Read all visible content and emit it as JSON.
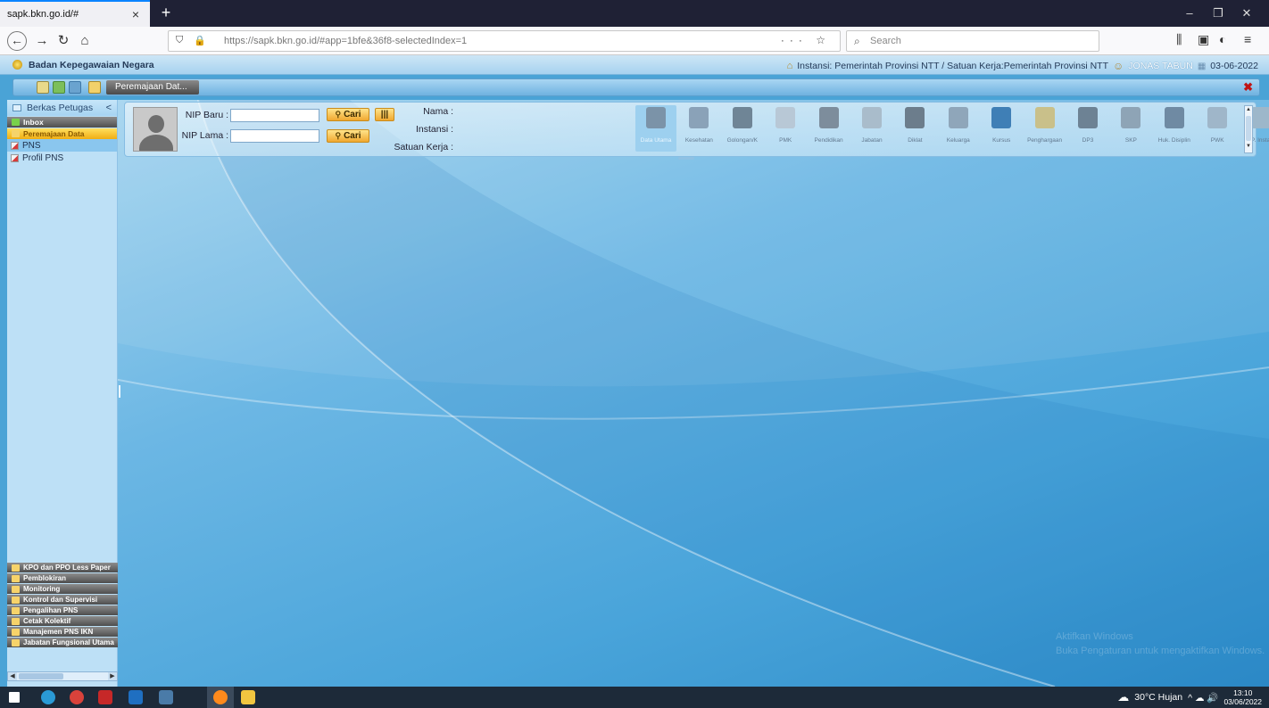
{
  "browser": {
    "tab_title": "sapk.bkn.go.id/#",
    "tab_close": "×",
    "new_tab": "+",
    "url": "https://sapk.bkn.go.id/#app=1bfe&36f8-selectedIndex=1",
    "search_placeholder": "Search",
    "url_actions": "··· ☆",
    "window_controls": [
      "–",
      "❐",
      "✕"
    ]
  },
  "header": {
    "org_name": "Badan Kepegawaian Negara",
    "instansi": "Instansi: Pemerintah Provinsi NTT / Satuan Kerja:Pemerintah Provinsi NTT",
    "user": "JONAS TABUN",
    "date": "03-06-2022"
  },
  "toolbar": {
    "tab_label": "Peremajaan Dat...",
    "close": "✖"
  },
  "sidebar": {
    "title": "Berkas Petugas",
    "collapse": "<",
    "groups_top": [
      {
        "label": "Inbox"
      },
      {
        "label": "Peremajaan Data"
      }
    ],
    "items": [
      {
        "label": "PNS"
      },
      {
        "label": "Profil PNS"
      }
    ],
    "groups_bottom": [
      {
        "label": "KPO dan PPO Less Paper"
      },
      {
        "label": "Pemblokiran"
      },
      {
        "label": "Monitoring"
      },
      {
        "label": "Kontrol dan Supervisi"
      },
      {
        "label": "Pengalihan PNS"
      },
      {
        "label": "Cetak Kolektif"
      },
      {
        "label": "Manajemen PNS IKN"
      },
      {
        "label": "Jabatan Fungsional Utama"
      }
    ]
  },
  "search": {
    "nip_baru_label": "NIP Baru :",
    "nip_lama_label": "NIP Lama :",
    "nip_baru_value": "",
    "nip_lama_value": "",
    "cari_label": "Cari",
    "barcode_label": "|||",
    "nama_label": "Nama :",
    "instansi_label": "Instansi :",
    "satuan_kerja_label": "Satuan Kerja :"
  },
  "modules": [
    {
      "label": "Data Utama",
      "icon": "database-icon",
      "color": "#7b93a8"
    },
    {
      "label": "Kesehatan",
      "icon": "health-icon",
      "color": "#8aa2b8"
    },
    {
      "label": "Golongan/K",
      "icon": "rank-icon",
      "color": "#6f8596"
    },
    {
      "label": "PMK",
      "icon": "magnifier-icon",
      "color": "#b8c8d6"
    },
    {
      "label": "Pendidikan",
      "icon": "graduate-icon",
      "color": "#7d8d9c"
    },
    {
      "label": "Jabatan",
      "icon": "id-card-icon",
      "color": "#a9bccb"
    },
    {
      "label": "Diklat",
      "icon": "book-icon",
      "color": "#6c7d8c"
    },
    {
      "label": "Keluarga",
      "icon": "family-icon",
      "color": "#8fa6ba"
    },
    {
      "label": "Kursus",
      "icon": "diamond-icon",
      "color": "#3f7fb6"
    },
    {
      "label": "Penghargaan",
      "icon": "medal-icon",
      "color": "#c9c08a"
    },
    {
      "label": "DP3",
      "icon": "document-icon",
      "color": "#6d8294"
    },
    {
      "label": "SKP",
      "icon": "people-icon",
      "color": "#8ea4b6"
    },
    {
      "label": "Huk. Disiplin",
      "icon": "person-icon",
      "color": "#6f8aa3"
    },
    {
      "label": "PWK",
      "icon": "map-icon",
      "color": "#9fb6c9"
    },
    {
      "label": "P. Insta",
      "icon": "chart-icon",
      "color": "#9db7ca"
    }
  ],
  "watermark": {
    "line1": "Aktifkan Windows",
    "line2": "Buka Pengaturan untuk mengaktifkan Windows."
  },
  "taskbar": {
    "weather": "30°C Hujan",
    "tray_icons": "^ ☁ 🔊",
    "time": "13:10",
    "date": "03/06/2022"
  }
}
